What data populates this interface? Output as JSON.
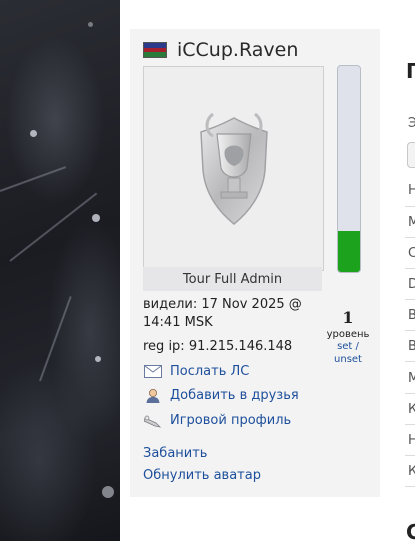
{
  "profile": {
    "nickname": "iCCup.Raven",
    "flag_colors": [
      "#2c3a8c",
      "#a41f2b",
      "#2a7a3a"
    ],
    "role": "Tour Full Admin",
    "last_seen": "видели: 17 Nov 2025 @ 14:41 MSK",
    "reg_ip": "reg ip: 91.215.146.148",
    "level": {
      "number": "1",
      "word": "уровень",
      "set_label": "set",
      "sep": " /",
      "unset_label": "unset",
      "fill_fraction": 0.2
    },
    "actions": [
      {
        "label": "Послать ЛС",
        "icon": "envelope-icon"
      },
      {
        "label": "Добавить в друзья",
        "icon": "add-friend-icon"
      },
      {
        "label": "Игровой профиль",
        "icon": "game-profile-icon"
      }
    ],
    "admin_actions": [
      "Забанить",
      "Обнулить аватар"
    ],
    "colors": {
      "link": "#1d4f9b",
      "meter_fill": "#1ca21c",
      "meter_empty": "#dfe2ea",
      "panel_bg": "#f3f3f4"
    }
  },
  "right_column": {
    "heading_top": "П",
    "heading_bottom": "С",
    "subheading": "Э",
    "row_letters": [
      "Н",
      "М",
      "С",
      "D",
      "В",
      "В",
      "М",
      "К",
      "Н",
      "К"
    ]
  }
}
